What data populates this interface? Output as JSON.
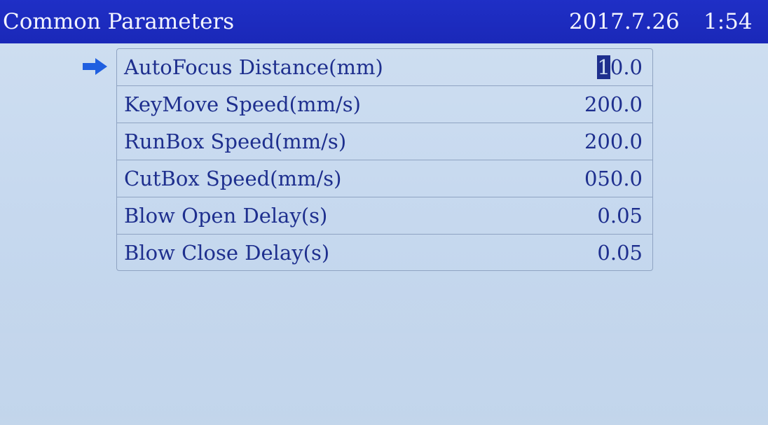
{
  "title_bar": {
    "title": "Common Parameters",
    "date": "2017.7.26",
    "time": "1:54"
  },
  "parameters": [
    {
      "label": "AutoFocus Distance(mm)",
      "value_cursor": "1",
      "value_rest": "0.0",
      "value": "10.0",
      "selected": true
    },
    {
      "label": "KeyMove Speed(mm/s)",
      "value": "200.0",
      "selected": false
    },
    {
      "label": "RunBox Speed(mm/s)",
      "value": "200.0",
      "selected": false
    },
    {
      "label": "CutBox Speed(mm/s)",
      "value": "050.0",
      "selected": false
    },
    {
      "label": "Blow Open Delay(s)",
      "value": "0.05",
      "selected": false
    },
    {
      "label": "Blow Close Delay(s)",
      "value": "0.05",
      "selected": false
    }
  ],
  "colors": {
    "title_bar": "#1f2fc6",
    "text": "#1e2f8e",
    "background": "#cfdff1",
    "selector_arrow": "#1f5fe0"
  },
  "icons": {
    "selector": "arrow-right-icon"
  }
}
